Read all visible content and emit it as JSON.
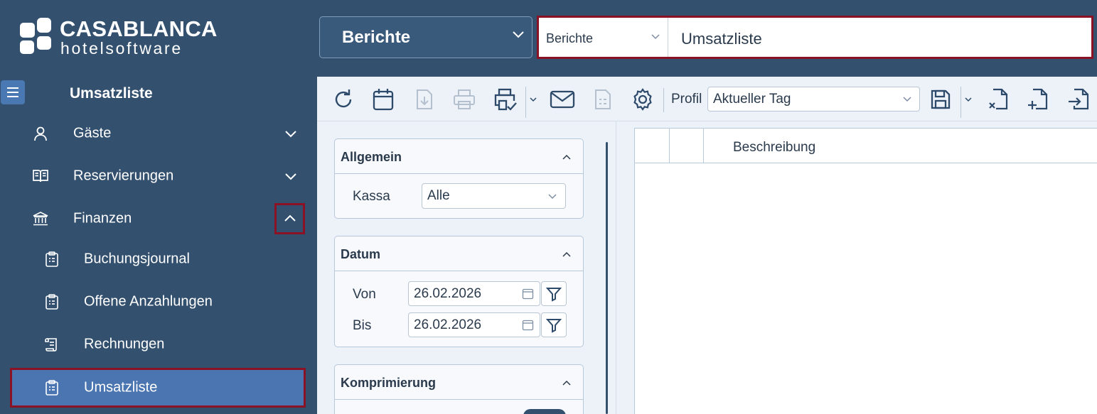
{
  "brand": {
    "title": "CASABLANCA",
    "subtitle": "hotelsoftware"
  },
  "sidebar": {
    "title": "Umsatzliste",
    "items": [
      {
        "label": "Gäste",
        "icon": "user-icon"
      },
      {
        "label": "Reservierungen",
        "icon": "book-icon"
      },
      {
        "label": "Finanzen",
        "icon": "bank-icon"
      }
    ],
    "subitems": [
      {
        "label": "Buchungsjournal",
        "icon": "clipboard-icon"
      },
      {
        "label": "Offene Anzahlungen",
        "icon": "clipboard-icon"
      },
      {
        "label": "Rechnungen",
        "icon": "scroll-icon"
      },
      {
        "label": "Umsatzliste",
        "icon": "clipboard-icon",
        "active": true
      }
    ]
  },
  "header": {
    "module": "Berichte",
    "report_category": "Berichte",
    "report_name": "Umsatzliste"
  },
  "toolbar": {
    "profil_label": "Profil",
    "profil_value": "Aktueller Tag"
  },
  "filters": {
    "allgemein": {
      "title": "Allgemein",
      "kassa_label": "Kassa",
      "kassa_value": "Alle"
    },
    "datum": {
      "title": "Datum",
      "von_label": "Von",
      "von_value": "26.02.2026",
      "bis_label": "Bis",
      "bis_value": "26.02.2026"
    },
    "komprimierung": {
      "title": "Komprimierung"
    }
  },
  "grid": {
    "column_beschreibung": "Beschreibung"
  },
  "colors": {
    "sidebar_bg": "#33506f",
    "active_item": "#4a75b0",
    "highlight_border": "#8b1224",
    "panel_bg": "#edf2f8"
  }
}
